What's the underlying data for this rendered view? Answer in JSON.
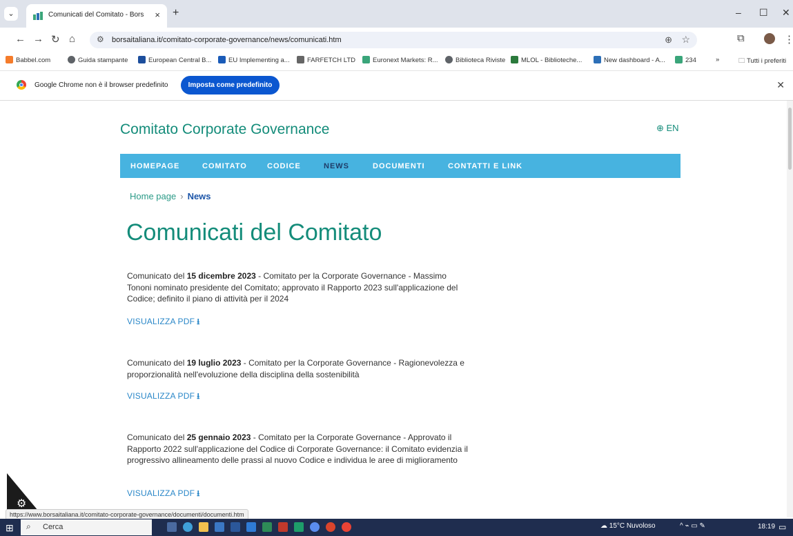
{
  "browser": {
    "tab_title": "Comunicati del Comitato - Bors",
    "tab_close": "×",
    "new_tab": "+",
    "url": "borsaitaliana.it/comitato-corporate-governance/news/comunicati.htm",
    "status_url": "https://www.borsaitaliana.it/comitato-corporate-governance/documenti/documenti.htm",
    "window_controls": {
      "minimize": "–",
      "maximize": "☐",
      "close": "✕"
    },
    "bookmarks": [
      {
        "label": "Babbel.com",
        "color": "#f57c2b"
      },
      {
        "label": "Guida stampante",
        "color": "#5f6368"
      },
      {
        "label": "European Central B...",
        "color": "#1c4e9c"
      },
      {
        "label": "EU Implementing a...",
        "color": "#1a5bb8"
      },
      {
        "label": "FARFETCH LTD",
        "color": "#666666"
      },
      {
        "label": "Euronext Markets: R...",
        "color": "#3aa57a"
      },
      {
        "label": "Biblioteca Riviste",
        "color": "#5f6368"
      },
      {
        "label": "MLOL - Biblioteche...",
        "color": "#2b7a3c"
      },
      {
        "label": "New dashboard - A...",
        "color": "#2d6fb7"
      },
      {
        "label": "234",
        "color": "#3aa57a"
      }
    ],
    "bookmarks_more": "»",
    "bookmarks_all": "Tutti i preferiti",
    "infobar": {
      "message": "Google Chrome non è il browser predefinito",
      "button": "Imposta come predefinito",
      "close": "✕"
    }
  },
  "site": {
    "title": "Comitato Corporate Governance",
    "lang": "EN",
    "menu": [
      "HOMEPAGE",
      "COMITATO",
      "CODICE",
      "NEWS",
      "DOCUMENTI",
      "CONTATTI E LINK"
    ],
    "breadcrumb": {
      "home": "Home page",
      "sep": "›",
      "current": "News"
    },
    "heading": "Comunicati del Comitato",
    "pdf_label": "VISUALIZZA PDF",
    "pdf_icon": "⭳",
    "releases": [
      {
        "prefix": "Comunicato del ",
        "date": "15 dicembre 2023",
        "text": " - Comitato per la Corporate Governance - Massimo Tononi nominato presidente del Comitato; approvato il Rapporto 2023 sull'applicazione del Codice; definito il piano di attività per il 2024"
      },
      {
        "prefix": "Comunicato del ",
        "date": "19 luglio 2023",
        "text": " - Comitato per la Corporate Governance - Ragionevolezza e proporzionalità nell'evoluzione della disciplina della sostenibilità"
      },
      {
        "prefix": "Comunicato del ",
        "date": "25 gennaio 2023",
        "text": " - Comitato per la Corporate Governance - Approvato il Rapporto 2022 sull'applicazione del Codice di Corporate Governance: il Comitato evidenzia il progressivo allineamento delle prassi al nuovo Codice e individua le aree di miglioramento"
      }
    ]
  },
  "taskbar": {
    "search": "Cerca",
    "weather": "15°C Nuvoloso",
    "time": "18:19"
  }
}
